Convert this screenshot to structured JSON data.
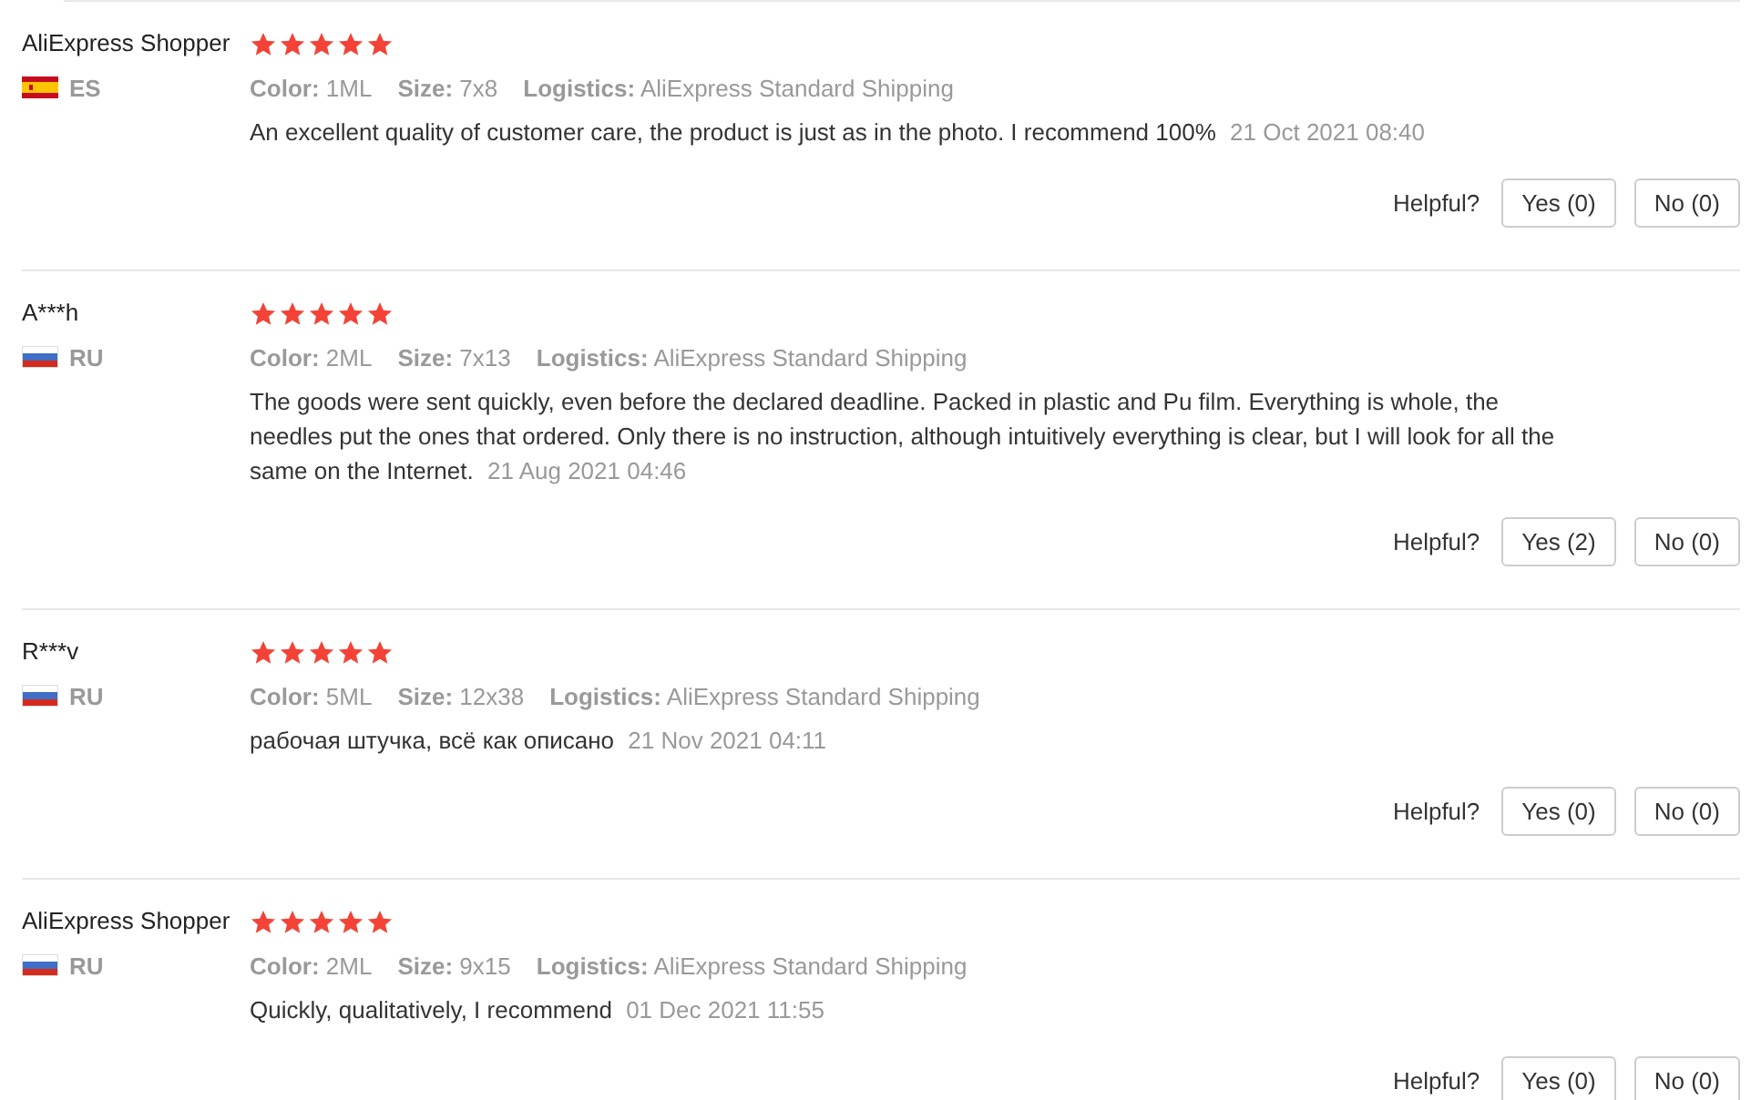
{
  "reviews": [
    {
      "name": "AliExpress Shopper",
      "country": {
        "code": "ES",
        "kind": "spain"
      },
      "stars": 5,
      "attributes": [
        {
          "label": "Color:",
          "value": "1ML"
        },
        {
          "label": "Size:",
          "value": "7x8"
        },
        {
          "label": "Logistics:",
          "value": "AliExpress Standard Shipping"
        }
      ],
      "text": "An excellent quality of customer care, the product is just as in the photo. I recommend 100%",
      "date": "21 Oct 2021 08:40",
      "helpful": "Helpful?",
      "yes": "Yes (0)",
      "no": "No (0)"
    },
    {
      "name": "A***h",
      "country": {
        "code": "RU",
        "kind": "russia"
      },
      "stars": 5,
      "attributes": [
        {
          "label": "Color:",
          "value": "2ML"
        },
        {
          "label": "Size:",
          "value": "7x13"
        },
        {
          "label": "Logistics:",
          "value": "AliExpress Standard Shipping"
        }
      ],
      "text": "The goods were sent quickly, even before the declared deadline. Packed in plastic and Pu film. Everything is whole, the needles put the ones that ordered. Only there is no instruction, although intuitively everything is clear, but I will look for all the same on the Internet.",
      "date": "21 Aug 2021 04:46",
      "helpful": "Helpful?",
      "yes": "Yes (2)",
      "no": "No (0)"
    },
    {
      "name": "R***v",
      "country": {
        "code": "RU",
        "kind": "russia"
      },
      "stars": 5,
      "attributes": [
        {
          "label": "Color:",
          "value": "5ML"
        },
        {
          "label": "Size:",
          "value": "12x38"
        },
        {
          "label": "Logistics:",
          "value": "AliExpress Standard Shipping"
        }
      ],
      "text": "рабочая штучка, всё как описано",
      "date": "21 Nov 2021 04:11",
      "helpful": "Helpful?",
      "yes": "Yes (0)",
      "no": "No (0)"
    },
    {
      "name": "AliExpress Shopper",
      "country": {
        "code": "RU",
        "kind": "russia"
      },
      "stars": 5,
      "attributes": [
        {
          "label": "Color:",
          "value": "2ML"
        },
        {
          "label": "Size:",
          "value": "9x15"
        },
        {
          "label": "Logistics:",
          "value": "AliExpress Standard Shipping"
        }
      ],
      "text": "Quickly, qualitatively, I recommend",
      "date": "01 Dec 2021 11:55",
      "helpful": "Helpful?",
      "yes": "Yes (0)",
      "no": "No (0)"
    }
  ]
}
